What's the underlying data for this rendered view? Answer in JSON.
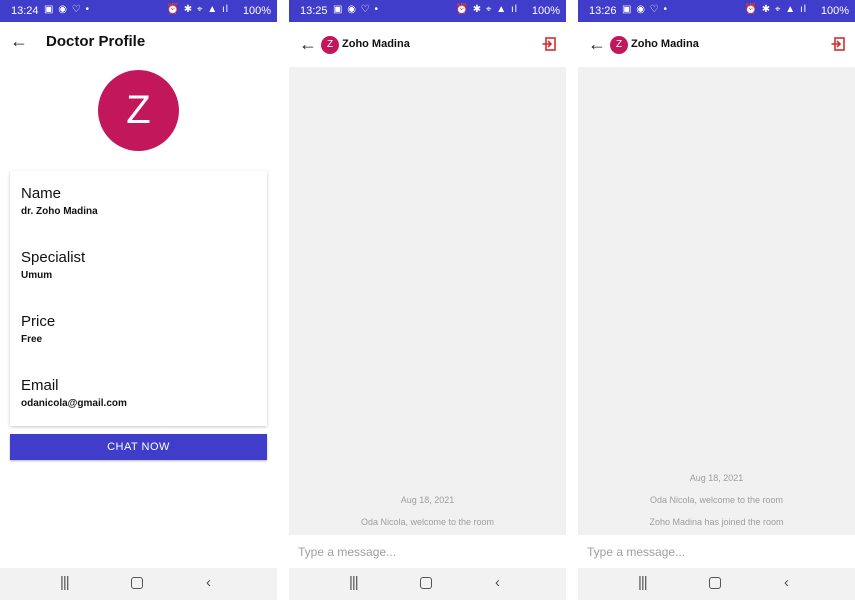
{
  "colors": {
    "primary": "#3f3dc9",
    "avatar": "#c2185b",
    "exit": "#d32f2f",
    "chat_bg": "#f1f1f1"
  },
  "status_bar": {
    "battery": "100%",
    "times": [
      "13:24",
      "13:25",
      "13:26"
    ]
  },
  "profile": {
    "title": "Doctor Profile",
    "avatar_letter": "Z",
    "fields": [
      {
        "label": "Name",
        "value": "dr. Zoho Madina"
      },
      {
        "label": "Specialist",
        "value": "Umum"
      },
      {
        "label": "Price",
        "value": "Free"
      },
      {
        "label": "Email",
        "value": "odanicola@gmail.com"
      }
    ],
    "chat_button": "CHAT NOW"
  },
  "chat": {
    "name": "Zoho Madina",
    "avatar_letter": "Z",
    "input_placeholder": "Type a message...",
    "screen2_messages": [
      "Aug 18, 2021",
      "Oda Nicola, welcome to the room"
    ],
    "screen3_messages": [
      "Aug 18, 2021",
      "Oda Nicola, welcome to the room",
      "Zoho Madina has joined the room"
    ]
  },
  "icons": {
    "back": "arrow-left-icon",
    "exit": "exit-icon",
    "recents": "recent-apps-icon",
    "home": "home-icon",
    "nav_back": "chevron-left-icon"
  }
}
